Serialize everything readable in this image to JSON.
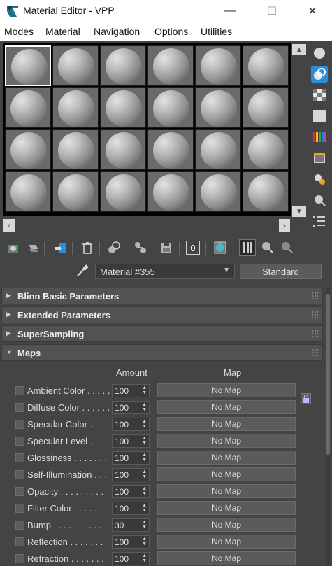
{
  "window": {
    "title": "Material Editor - VPP",
    "minimize": "—",
    "maximize": "☐",
    "close": "✕"
  },
  "menu": [
    "Modes",
    "Material",
    "Navigation",
    "Options",
    "Utilities"
  ],
  "slots": {
    "rows": 4,
    "cols": 6,
    "active_index": 0
  },
  "side_tools": [
    "sample-sphere-icon",
    "backlight-icon",
    "checker-background-icon",
    "sample-uv-tiling-icon",
    "video-color-check-icon",
    "make-preview-icon",
    "options-icon",
    "select-by-material-icon",
    "material-map-navigator-icon"
  ],
  "toolbar_icons": [
    "get-material-icon",
    "put-to-scene-icon",
    "assign-to-selection-icon",
    "reset-map-icon",
    "copy-material-icon",
    "make-unique-icon",
    "put-to-library-icon",
    "material-id-channel-icon",
    "show-shaded-material-icon",
    "show-end-result-icon",
    "go-to-parent-icon",
    "go-forward-to-sibling-icon"
  ],
  "material_id_channel": "0",
  "material": {
    "name": "Material #355",
    "type": "Standard"
  },
  "rollouts": [
    {
      "title": "Blinn Basic Parameters",
      "expanded": false
    },
    {
      "title": "Extended Parameters",
      "expanded": false
    },
    {
      "title": "SuperSampling",
      "expanded": false
    },
    {
      "title": "Maps",
      "expanded": true
    }
  ],
  "maps": {
    "amount_header": "Amount",
    "map_header": "Map",
    "rows": [
      {
        "label": "Ambient Color . . . . .",
        "amount": "100",
        "map": "No Map"
      },
      {
        "label": "Diffuse Color . . . . . .",
        "amount": "100",
        "map": "No Map"
      },
      {
        "label": "Specular Color  . . . .",
        "amount": "100",
        "map": "No Map"
      },
      {
        "label": "Specular Level  . . . .",
        "amount": "100",
        "map": "No Map"
      },
      {
        "label": "Glossiness  . . . . . . .",
        "amount": "100",
        "map": "No Map"
      },
      {
        "label": "Self-Illumination . . .",
        "amount": "100",
        "map": "No Map"
      },
      {
        "label": "Opacity . . . . . . . . .",
        "amount": "100",
        "map": "No Map"
      },
      {
        "label": "Filter Color  . . . . . .",
        "amount": "100",
        "map": "No Map"
      },
      {
        "label": "Bump  . . . . . . . . . .",
        "amount": "30",
        "map": "No Map"
      },
      {
        "label": "Reflection  . . . . . . .",
        "amount": "100",
        "map": "No Map"
      },
      {
        "label": "Refraction  . . . . . . .",
        "amount": "100",
        "map": "No Map"
      }
    ]
  },
  "colors": {
    "panel_bg": "#444444",
    "slot_bg": "#6a6a6a",
    "accent": "#2a8fd6"
  }
}
